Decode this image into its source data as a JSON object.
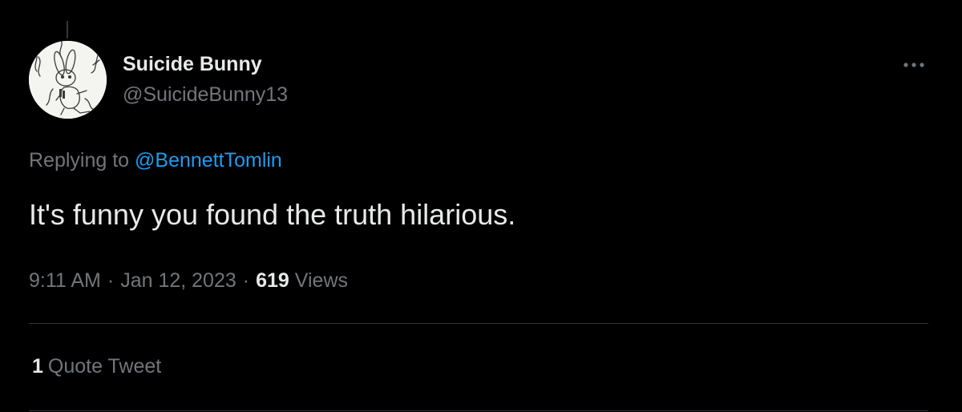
{
  "author": {
    "display_name": "Suicide Bunny",
    "handle": "@SuicideBunny13"
  },
  "reply": {
    "prefix": "Replying to",
    "mention": "@BennettTomlin"
  },
  "tweet": {
    "text": "It's funny you found the truth hilarious."
  },
  "meta": {
    "time": "9:11 AM",
    "separator": "·",
    "date": "Jan 12, 2023",
    "views_count": "619",
    "views_label": "Views"
  },
  "stats": {
    "quote_count": "1",
    "quote_label": "Quote Tweet"
  },
  "icons": {
    "more": "more-horizontal-icon"
  },
  "colors": {
    "background": "#000000",
    "primary_text": "#e7e9ea",
    "secondary_text": "#71767b",
    "link": "#1d9bf0",
    "divider": "#2f3336"
  }
}
